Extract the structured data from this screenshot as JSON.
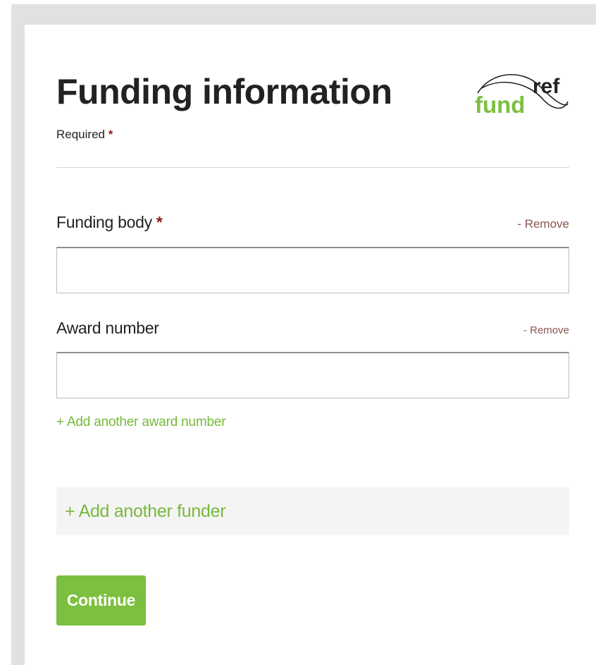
{
  "header": {
    "title": "Funding information",
    "required_label": "Required",
    "required_marker": "*"
  },
  "logo": {
    "word_ref": "ref",
    "word_fund": "fund",
    "color_fund": "#7dbf3e",
    "color_ref": "#222222"
  },
  "funding_body": {
    "label": "Funding body",
    "required_marker": "*",
    "remove_label": "- Remove",
    "value": ""
  },
  "award_number": {
    "label": "Award number",
    "remove_label": "- Remove",
    "value": ""
  },
  "actions": {
    "add_award_label": "+ Add another award number",
    "add_funder_label": "+ Add another funder",
    "continue_label": "Continue"
  },
  "colors": {
    "accent_green": "#7dbf3e",
    "remove_link": "#8c5550",
    "required_marker": "#8b1e1e"
  },
  "icons": [
    "fundref-logo"
  ]
}
